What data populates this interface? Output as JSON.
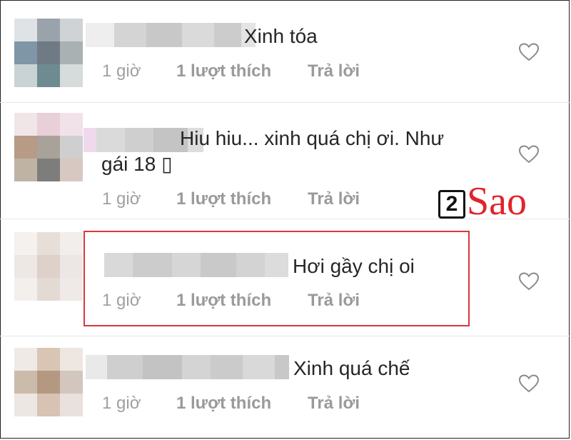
{
  "comments": [
    {
      "text": "Xinh tóa",
      "time": "1 giờ",
      "likes": "1 lượt thích",
      "reply": "Trả lời"
    },
    {
      "text": "Hiu hiu... xinh quá chị ơi. Như gái 18 ▯",
      "time": "1 giờ",
      "likes": "1 lượt thích",
      "reply": "Trả lời"
    },
    {
      "text": "Hơi gầy chị oi",
      "time": "1 giờ",
      "likes": "1 lượt thích",
      "reply": "Trả lời"
    },
    {
      "text": "Xinh quá chế",
      "time": "1 giờ",
      "likes": "1 lượt thích",
      "reply": "Trả lời"
    }
  ],
  "watermark": {
    "number": "2",
    "brand": "Sao"
  },
  "colors": {
    "highlight": "#d9363e",
    "watermark_red": "#e2232a",
    "meta_gray": "#a0a0a0"
  }
}
